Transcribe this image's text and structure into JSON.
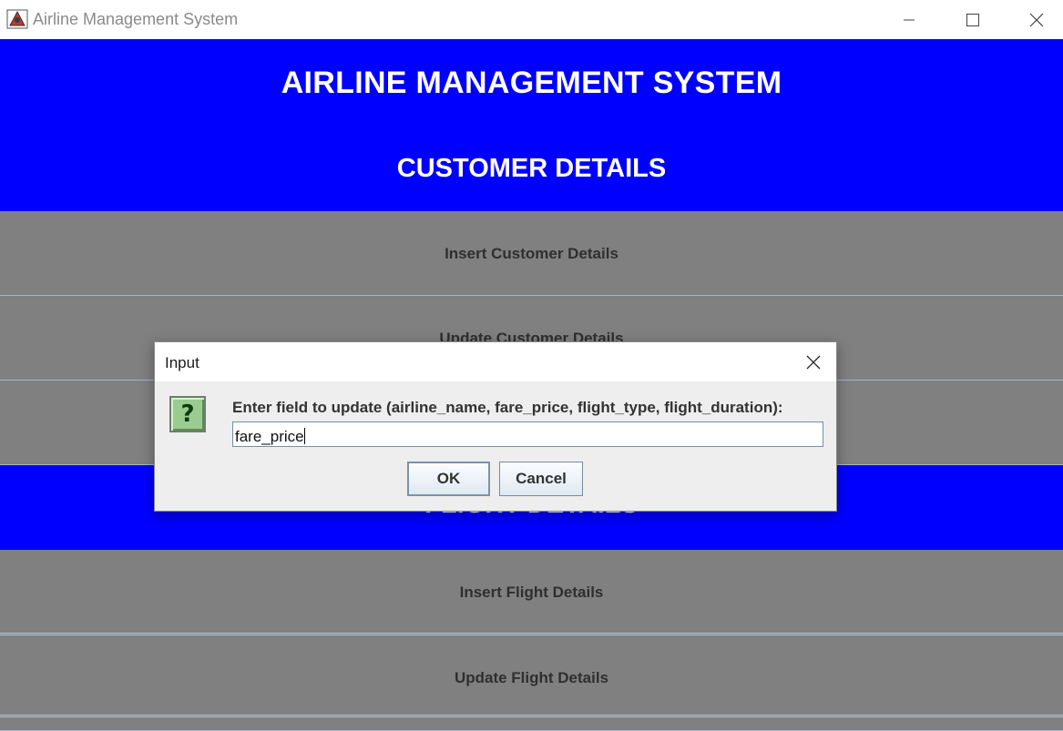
{
  "window": {
    "title": "Airline Management System",
    "icons": {
      "app": "java-app-icon",
      "minimize": "minimize-icon",
      "maximize": "maximize-icon",
      "close": "close-icon"
    }
  },
  "main": {
    "title": "AIRLINE MANAGEMENT SYSTEM",
    "customer_section": {
      "title": "CUSTOMER DETAILS",
      "buttons": {
        "insert": "Insert Customer Details",
        "update": "Update Customer Details"
      }
    },
    "flight_section": {
      "title": "FLIGHT DETAILS",
      "buttons": {
        "insert": "Insert Flight Details",
        "update": "Update Flight Details"
      }
    }
  },
  "dialog": {
    "title": "Input",
    "icon": "question-icon",
    "icon_glyph": "?",
    "prompt": "Enter field to update (airline_name, fare_price, flight_type, flight_duration):",
    "input_value": "fare_price",
    "ok_label": "OK",
    "cancel_label": "Cancel"
  },
  "colors": {
    "header_blue": "#0000ff",
    "button_gray": "#808080",
    "text_white": "#ffffff"
  }
}
